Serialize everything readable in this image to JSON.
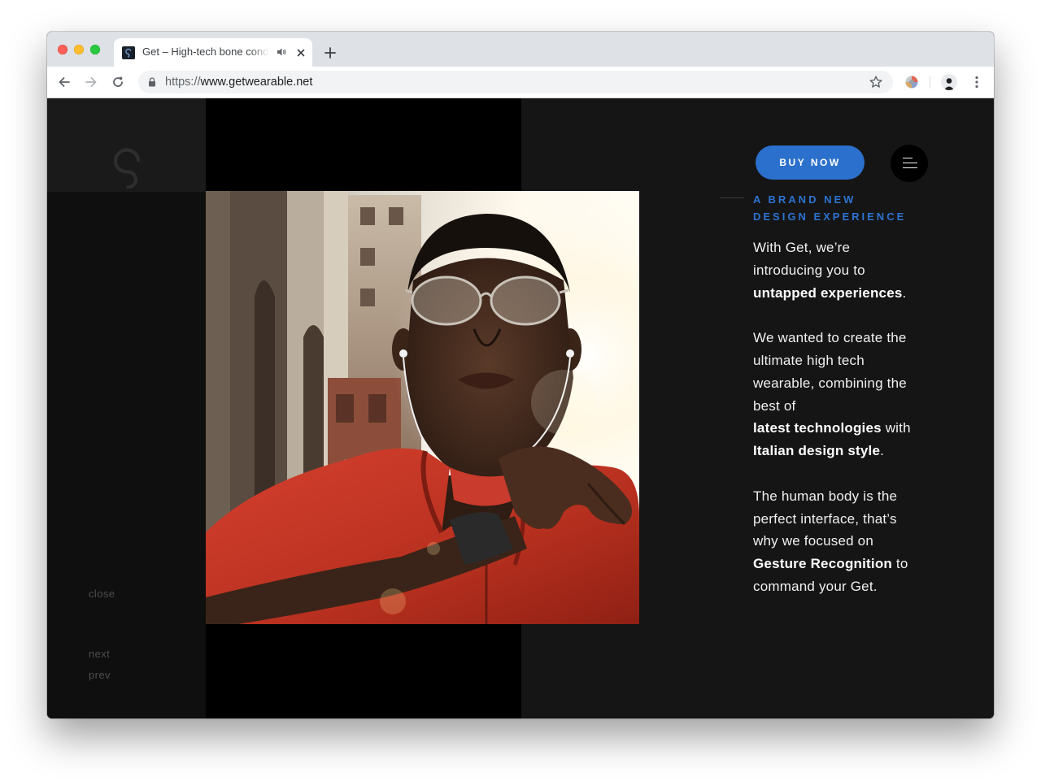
{
  "browser": {
    "tab_title": "Get – High-tech bone conduction wearable",
    "url_scheme": "https://",
    "url_host": "www.getwearable.net"
  },
  "nav": {
    "close": "close",
    "next": "next",
    "prev": "prev"
  },
  "header": {
    "buy_label": "BUY NOW"
  },
  "intro": {
    "eyebrow_line1": "A BRAND NEW",
    "eyebrow_line2": "DESIGN EXPERIENCE",
    "p1": {
      "l1": "With Get, we’re",
      "l2": "introducing you to",
      "b1": "untapped experiences",
      "t1": "."
    },
    "p2": {
      "l1": "We wanted to create the",
      "l2": "ultimate high tech",
      "l3": "wearable, combining the",
      "l4": "best of",
      "b1": "latest technologies",
      "t1": " with",
      "b2": "Italian design style",
      "t2": "."
    },
    "p3": {
      "l1": "The human body is the",
      "l2": "perfect interface, that’s",
      "l3": "why we focused on",
      "b1": "Gesture Recognition",
      "t1": " to",
      "l4": "command your Get."
    }
  },
  "icons": {
    "back": "arrow-left-icon",
    "forward": "arrow-right-icon",
    "reload": "reload-icon",
    "lock": "lock-icon",
    "bookmark": "star-icon",
    "menu": "hamburger-icon",
    "logo": "get-logo-mark"
  },
  "colors": {
    "accent": "#2b70cc",
    "eyebrow": "#2d73d1",
    "page_bg": "#151515",
    "side_panel": "#0f0f0f",
    "band": "#000000",
    "jacket": "#c9362b"
  }
}
